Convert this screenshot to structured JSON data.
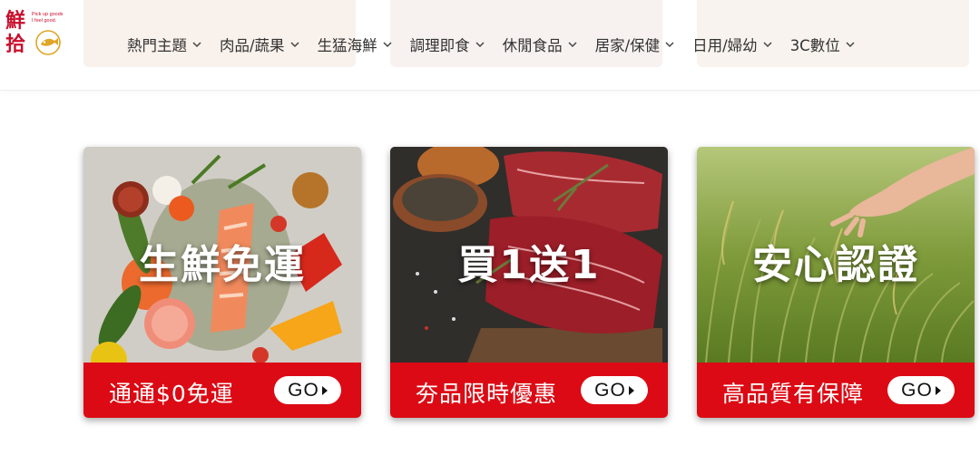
{
  "brand": {
    "logo_chars": [
      "鮮",
      "拾"
    ],
    "tagline": [
      "Pick up goods",
      "I feel good."
    ],
    "color": "#c8102e"
  },
  "nav": {
    "items": [
      {
        "label": "熱門主題",
        "icon": "chevron-down-icon"
      },
      {
        "label": "肉品/蔬果",
        "icon": "chevron-down-icon"
      },
      {
        "label": "生猛海鮮",
        "icon": "chevron-down-icon"
      },
      {
        "label": "調理即食",
        "icon": "chevron-down-icon"
      },
      {
        "label": "休閒食品",
        "icon": "chevron-down-icon"
      },
      {
        "label": "居家/保健",
        "icon": "chevron-down-icon"
      },
      {
        "label": "日用/婦幼",
        "icon": "chevron-down-icon"
      },
      {
        "label": "3C數位",
        "icon": "chevron-down-icon"
      }
    ]
  },
  "promos": [
    {
      "title": "生鮮免運",
      "subtitle": "通通$0免運",
      "button": "GO",
      "image": "vegetables-and-salmon"
    },
    {
      "title": "買1送1",
      "subtitle": "夯品限時優惠",
      "button": "GO",
      "image": "raw-steak"
    },
    {
      "title": "安心認證",
      "subtitle": "高品質有保障",
      "button": "GO",
      "image": "rice-field"
    }
  ],
  "colors": {
    "accent_red": "#dc0a14",
    "text": "#333333"
  }
}
